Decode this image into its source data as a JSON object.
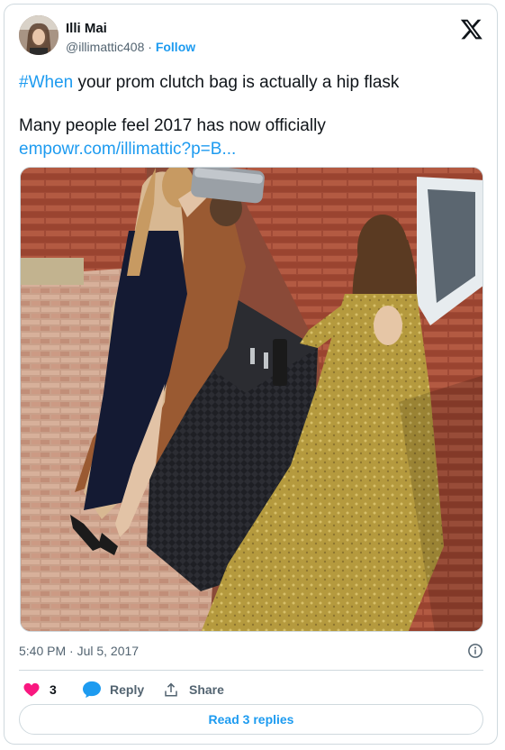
{
  "author": {
    "display_name": "Illi Mai",
    "handle": "@illimattic408",
    "separator": "·",
    "follow_label": "Follow",
    "avatar_icon": "avatar-photo"
  },
  "brand_icon": "x-logo-icon",
  "tweet": {
    "hashtag": "#When",
    "line1_rest": " your prom clutch bag is actually a hip flask",
    "line2": "Many people feel 2017 has now officially",
    "link": "empowr.com/illimattic?p=B..."
  },
  "media": {
    "kind": "photo",
    "subject": "three women in prom dresses beside a brick wall"
  },
  "timestamp": "5:40 PM · Jul 5, 2017",
  "actions": {
    "likes_count": "3",
    "reply_label": "Reply",
    "share_label": "Share"
  },
  "read_replies_label": "Read 3 replies",
  "colors": {
    "accent": "#1d9bf0",
    "like": "#f91880",
    "text": "#0f1419",
    "muted": "#536471",
    "border": "#cfd9de"
  }
}
